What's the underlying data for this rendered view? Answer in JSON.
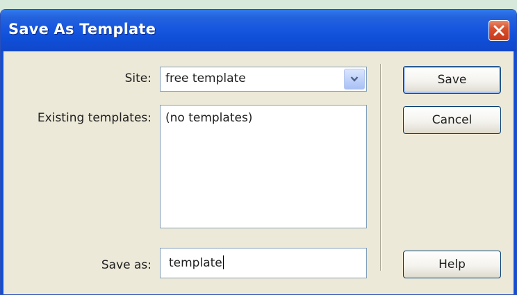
{
  "window": {
    "title": "Save As Template",
    "titlebar_color": "#1757e0",
    "close_icon": "close-icon"
  },
  "form": {
    "site_label": "Site:",
    "site_value": "free template",
    "existing_label": "Existing templates:",
    "existing_items": [
      "(no templates)"
    ],
    "save_as_label": "Save as:",
    "save_as_value": "template"
  },
  "buttons": {
    "save": "Save",
    "cancel": "Cancel",
    "help": "Help"
  }
}
